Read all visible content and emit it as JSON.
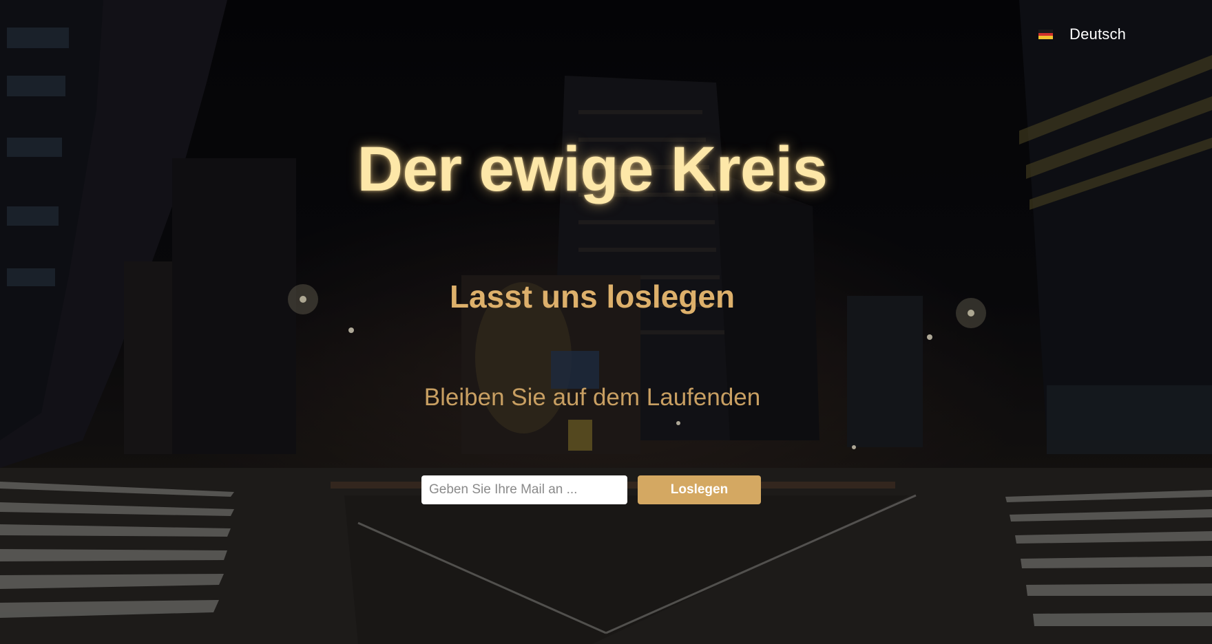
{
  "language": {
    "label": "Deutsch",
    "flag_icon": "germany-flag-icon",
    "flag_colors": [
      "#1a1a1a",
      "#d0312d",
      "#f2c230"
    ]
  },
  "hero": {
    "title": "Der ewige Kreis",
    "subtitle": "Lasst uns loslegen",
    "tagline": "Bleiben Sie auf dem Laufenden"
  },
  "signup": {
    "email_placeholder": "Geben Sie Ihre Mail an ...",
    "email_value": "",
    "button_label": "Loslegen"
  },
  "colors": {
    "title": "#fde7a8",
    "subtitle": "#ddb06b",
    "tagline": "#c89f62",
    "button": "#d4a862"
  }
}
